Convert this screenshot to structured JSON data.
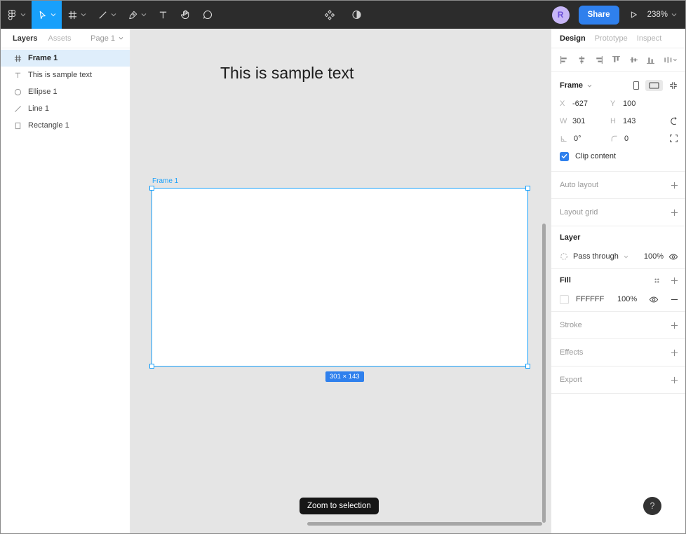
{
  "toolbar": {
    "zoom_level": "238%",
    "share_label": "Share",
    "avatar_initial": "R"
  },
  "left_panel": {
    "layers_tab": "Layers",
    "assets_tab": "Assets",
    "page_selector": "Page 1",
    "layers": [
      {
        "name": "Frame 1",
        "icon": "frame-icon",
        "selected": true
      },
      {
        "name": "This is sample text",
        "icon": "text-icon",
        "selected": false
      },
      {
        "name": "Ellipse 1",
        "icon": "ellipse-icon",
        "selected": false
      },
      {
        "name": "Line 1",
        "icon": "line-icon",
        "selected": false
      },
      {
        "name": "Rectangle 1",
        "icon": "rectangle-icon",
        "selected": false
      }
    ]
  },
  "canvas": {
    "text_element": "This is sample text",
    "frame_label": "Frame 1",
    "size_badge": "301 × 143",
    "tooltip": "Zoom to selection"
  },
  "right_panel": {
    "tabs": {
      "design": "Design",
      "prototype": "Prototype",
      "inspect": "Inspect"
    },
    "frame": {
      "title": "Frame",
      "x_label": "X",
      "x_value": "-627",
      "y_label": "Y",
      "y_value": "100",
      "w_label": "W",
      "w_value": "301",
      "h_label": "H",
      "h_value": "143",
      "rotation_value": "0°",
      "radius_value": "0",
      "clip_label": "Clip content"
    },
    "auto_layout_label": "Auto layout",
    "layout_grid_label": "Layout grid",
    "layer_section": {
      "title": "Layer",
      "blend_mode": "Pass through",
      "opacity": "100%"
    },
    "fill_section": {
      "title": "Fill",
      "hex": "FFFFFF",
      "opacity": "100%"
    },
    "stroke_label": "Stroke",
    "effects_label": "Effects",
    "export_label": "Export"
  },
  "help_button_label": "?",
  "colors": {
    "accent": "#18a0fb",
    "button_blue": "#2f80ed",
    "toolbar_bg": "#2c2c2c",
    "canvas_bg": "#e5e5e5",
    "selected_row": "#dfeefb"
  }
}
